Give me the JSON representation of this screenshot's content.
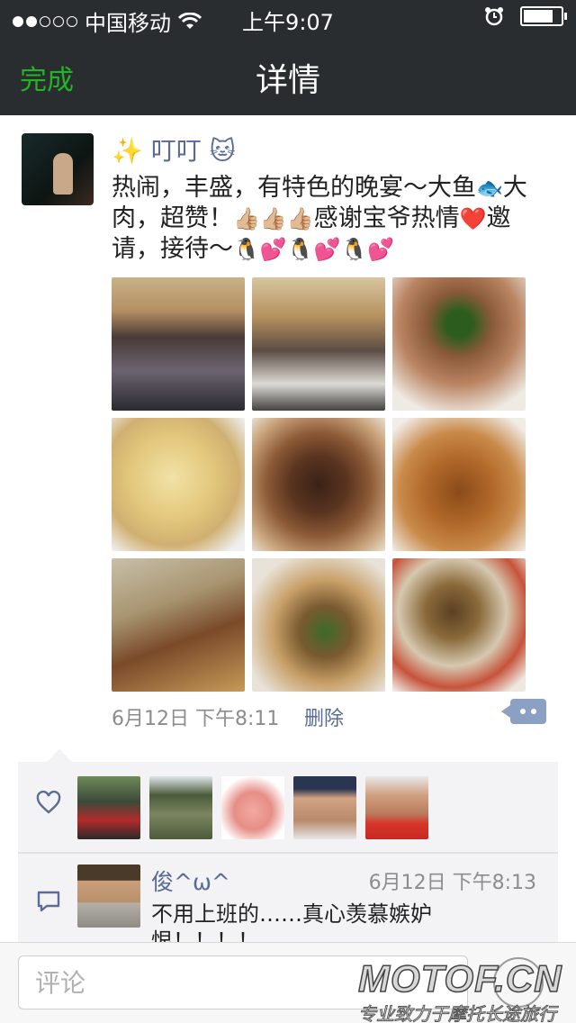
{
  "status_bar": {
    "carrier": "中国移动",
    "time": "上午9:07"
  },
  "nav": {
    "done_label": "完成",
    "title": "详情"
  },
  "post": {
    "author": "✨ 叮叮 🐱",
    "text_segments": {
      "a": "热闹，丰盛，有特色的晚宴～大鱼",
      "fish": "🐟",
      "b": "大肉，超赞！",
      "thumbs": "👍🏼👍🏼👍🏼",
      "c": "感谢宝爷热情",
      "heart": "❤️",
      "d": "邀请，接待～",
      "penguins": "🐧💕🐧💕🐧💕"
    },
    "photo_count": 9,
    "date": "6月12日",
    "time": "下午8:11",
    "delete_label": "删除"
  },
  "likes": {
    "count": 5
  },
  "comment": {
    "name": "俊^ω^",
    "time": "6月12日 下午8:13",
    "text": "不用上班的……真心羡慕嫉妒恨！！！！"
  },
  "input": {
    "placeholder": "评论"
  },
  "watermark": {
    "top": "MOTOF.CN",
    "bottom": "专业致力于摩托长途旅行"
  },
  "colors": {
    "nav_bg": "#2a2d2f",
    "accent_green": "#21b526",
    "link_blue": "#576b95",
    "more_button": "#8ba0c2"
  }
}
